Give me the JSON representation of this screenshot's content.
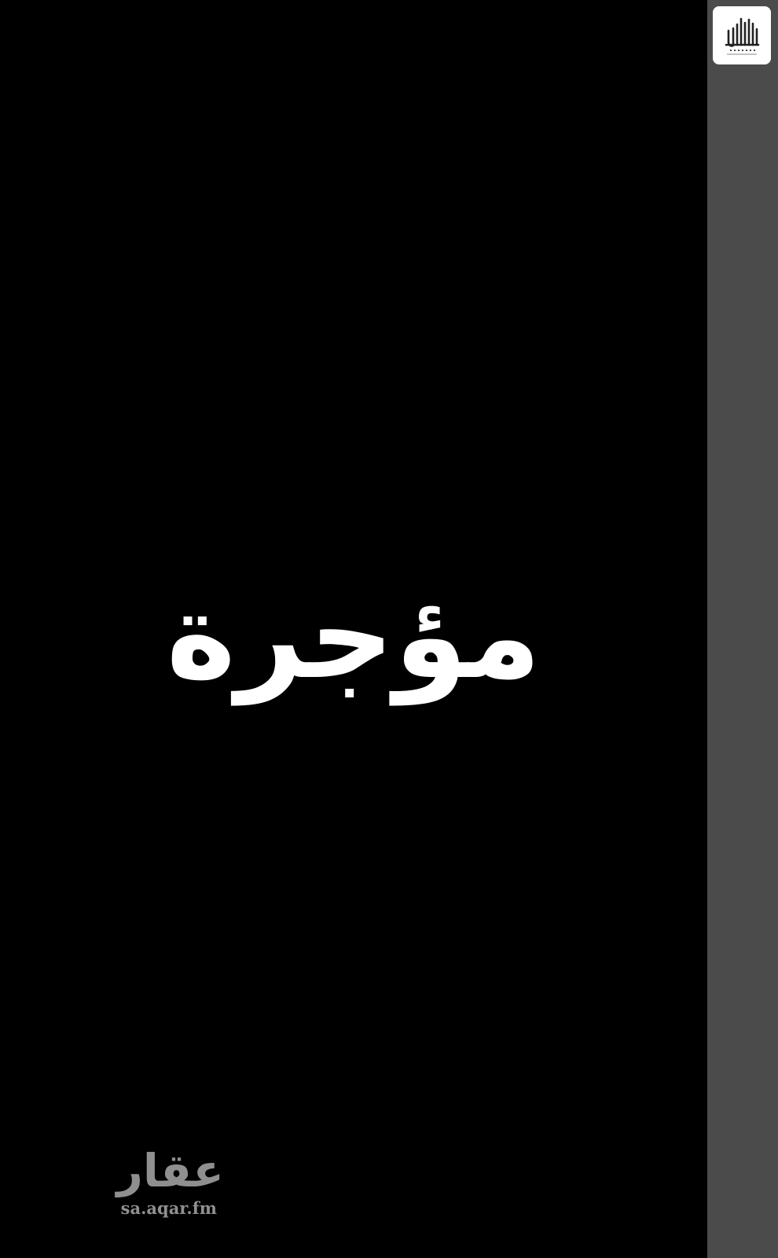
{
  "main": {
    "status_text": "مؤجرة"
  },
  "watermark": {
    "arabic": "عقار",
    "domain": "sa.aqar.fm"
  },
  "brand_logo": {
    "icon": "buildings-logo-icon",
    "background_color": "#ffffff"
  },
  "colors": {
    "background": "#000000",
    "side_strip": "#4b4b4b",
    "text": "#ffffff",
    "watermark": "#8f8f8f"
  }
}
